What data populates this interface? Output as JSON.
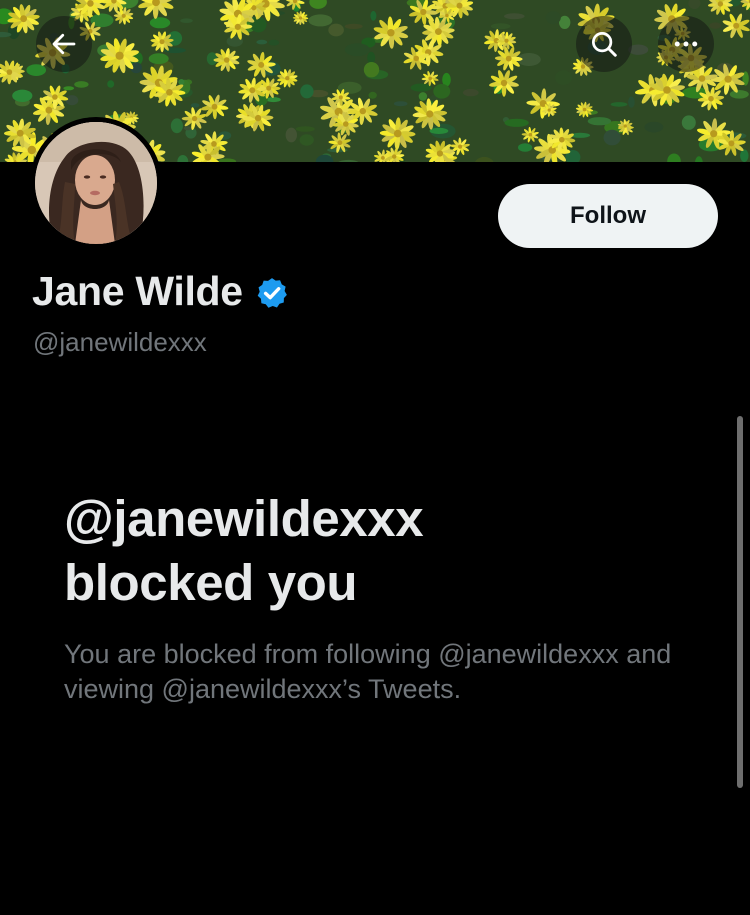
{
  "header": {
    "back_icon": "arrow-left-icon",
    "search_icon": "search-icon",
    "more_icon": "more-horizontal-icon"
  },
  "profile": {
    "display_name": "Jane Wilde",
    "handle": "@janewildexxx",
    "verified": true,
    "verified_icon": "verified-badge-icon",
    "follow_label": "Follow"
  },
  "blocked": {
    "title_line1": "@janewildexxx",
    "title_line2": "blocked you",
    "description": "You are blocked from following @janewildexxx and viewing @janewildexxx’s Tweets."
  },
  "colors": {
    "background": "#000000",
    "primary_text": "#e7e9ea",
    "secondary_text": "#71767b",
    "follow_bg": "#eff3f4",
    "verified_blue": "#1d9bf0"
  }
}
